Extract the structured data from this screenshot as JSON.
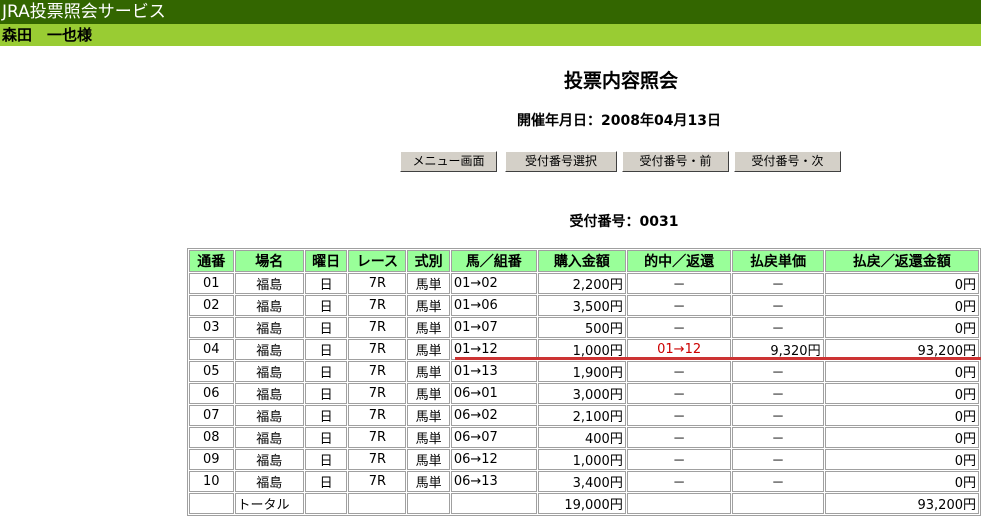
{
  "app_title": "JRA投票照会サービス",
  "user_name": "森田　一也様",
  "page_title": "投票内容照会",
  "date_line": "開催年月日：2008年04月13日",
  "buttons": {
    "menu": "メニュー画面",
    "select": "受付番号選択",
    "prev": "受付番号・前",
    "next": "受付番号・次"
  },
  "receipt_line": "受付番号：0031",
  "colors": {
    "title_bar": "#336600",
    "user_bar": "#99cc33",
    "header": "#99ff99",
    "hit": "#cc0000"
  },
  "table": {
    "headers": [
      "通番",
      "場名",
      "曜日",
      "レース",
      "式別",
      "馬／組番",
      "購入金額",
      "的中／返還",
      "払戻単価",
      "払戻／返還金額"
    ],
    "rows": [
      [
        "01",
        "福島",
        "日",
        "7R",
        "馬単",
        "01→02",
        "2,200円",
        "－",
        "－",
        "0円"
      ],
      [
        "02",
        "福島",
        "日",
        "7R",
        "馬単",
        "01→06",
        "3,500円",
        "－",
        "－",
        "0円"
      ],
      [
        "03",
        "福島",
        "日",
        "7R",
        "馬単",
        "01→07",
        "500円",
        "－",
        "－",
        "0円"
      ],
      [
        "04",
        "福島",
        "日",
        "7R",
        "馬単",
        "01→12",
        "1,000円",
        "01→12",
        "9,320円",
        "93,200円"
      ],
      [
        "05",
        "福島",
        "日",
        "7R",
        "馬単",
        "01→13",
        "1,900円",
        "－",
        "－",
        "0円"
      ],
      [
        "06",
        "福島",
        "日",
        "7R",
        "馬単",
        "06→01",
        "3,000円",
        "－",
        "－",
        "0円"
      ],
      [
        "07",
        "福島",
        "日",
        "7R",
        "馬単",
        "06→02",
        "2,100円",
        "－",
        "－",
        "0円"
      ],
      [
        "08",
        "福島",
        "日",
        "7R",
        "馬単",
        "06→07",
        "400円",
        "－",
        "－",
        "0円"
      ],
      [
        "09",
        "福島",
        "日",
        "7R",
        "馬単",
        "06→12",
        "1,000円",
        "－",
        "－",
        "0円"
      ],
      [
        "10",
        "福島",
        "日",
        "7R",
        "馬単",
        "06→13",
        "3,400円",
        "－",
        "－",
        "0円"
      ]
    ],
    "hit_row": 3,
    "total": {
      "label": "トータル",
      "purchase": "19,000円",
      "payout": "93,200円"
    }
  }
}
